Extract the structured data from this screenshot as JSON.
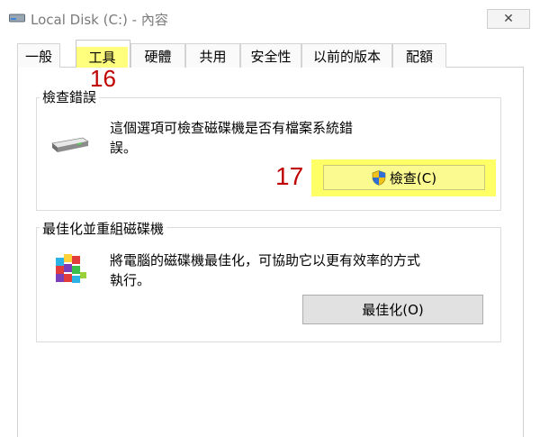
{
  "window": {
    "title": "Local Disk (C:) - 內容",
    "close_glyph": "✕"
  },
  "tabs": [
    {
      "label": "一般"
    },
    {
      "label": "工具"
    },
    {
      "label": "硬體"
    },
    {
      "label": "共用"
    },
    {
      "label": "安全性"
    },
    {
      "label": "以前的版本"
    },
    {
      "label": "配額"
    }
  ],
  "active_tab": "工具",
  "annotations": {
    "tab_step": "16",
    "button_step": "17"
  },
  "error_checking": {
    "title": "檢查錯誤",
    "desc_line1": "這個選項可檢查磁碟機是否有檔案系統錯",
    "desc_line2": "誤。",
    "button_label": "檢查(C)",
    "icon": "drive-icon"
  },
  "optimize": {
    "title": "最佳化並重組磁碟機",
    "desc_line1": "將電腦的磁碟機最佳化，可協助它以更有效率的方式",
    "desc_line2": "執行。",
    "button_label": "最佳化(O)",
    "icon": "defrag-icon"
  },
  "colors": {
    "highlight": "#ffff66",
    "annotation": "#c00000"
  }
}
